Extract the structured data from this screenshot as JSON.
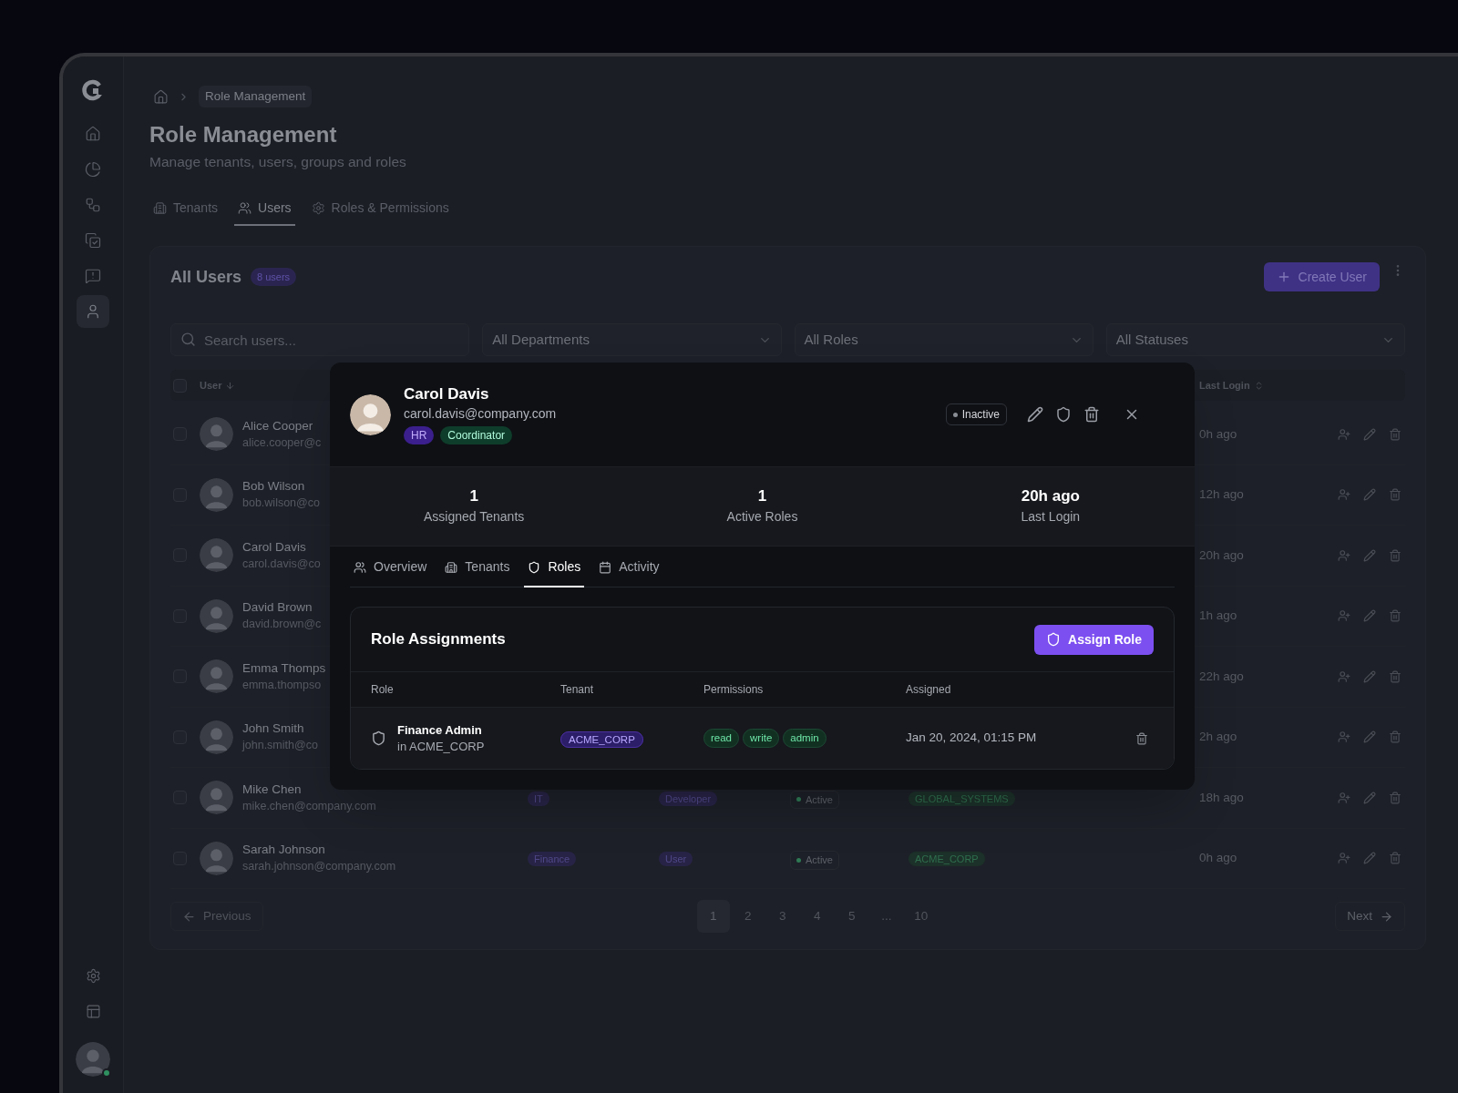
{
  "sidebar": {
    "items": [
      {
        "selected": false
      },
      {
        "selected": false
      },
      {
        "selected": false
      },
      {
        "selected": false
      },
      {
        "selected": false
      },
      {
        "selected": true
      }
    ],
    "bottom_items": [
      {
        "selected": false
      },
      {
        "selected": false
      }
    ],
    "user_avatar": {
      "online": true
    }
  },
  "breadcrumb": {
    "current": "Role Management"
  },
  "header": {
    "title": "Role Management",
    "subtitle": "Manage tenants, users, groups and roles"
  },
  "tabs": [
    {
      "label": "Tenants",
      "selected": false
    },
    {
      "label": "Users",
      "selected": true
    },
    {
      "label": "Roles & Permissions",
      "selected": false
    }
  ],
  "users_card": {
    "title": "All Users",
    "count": "8 users",
    "create_button": "Create User",
    "search": {
      "placeholder": "Search users..."
    },
    "filters": [
      "All Departments",
      "All Roles",
      "All Statuses"
    ],
    "columns": {
      "select_all_checked": false,
      "user": "User",
      "last_login": "Last Login"
    },
    "rows": [
      {
        "checked": false,
        "name": "Alice Cooper",
        "email": "alice.cooper@c",
        "last_login": "0h ago"
      },
      {
        "checked": false,
        "name": "Bob Wilson",
        "email": "bob.wilson@co",
        "last_login": "12h ago"
      },
      {
        "checked": false,
        "name": "Carol Davis",
        "email": "carol.davis@co",
        "last_login": "20h ago"
      },
      {
        "checked": false,
        "name": "David Brown",
        "email": "david.brown@c",
        "last_login": "1h ago"
      },
      {
        "checked": false,
        "name": "Emma Thomps",
        "email": "emma.thompso",
        "last_login": "22h ago"
      },
      {
        "checked": false,
        "name": "John Smith",
        "email": "john.smith@co",
        "last_login": "2h ago"
      },
      {
        "checked": false,
        "name": "Mike Chen",
        "email": "mike.chen@company.com",
        "department": "IT",
        "role": "Developer",
        "status": "Active",
        "tenant": "GLOBAL_SYSTEMS",
        "last_login": "18h ago"
      },
      {
        "checked": false,
        "name": "Sarah Johnson",
        "email": "sarah.johnson@company.com",
        "department": "Finance",
        "role": "User",
        "status": "Active",
        "tenant": "ACME_CORP",
        "last_login": "0h ago"
      }
    ],
    "pagination": {
      "previous": "Previous",
      "pages": [
        {
          "label": "1",
          "selected": true
        },
        {
          "label": "2",
          "selected": false
        },
        {
          "label": "3",
          "selected": false
        },
        {
          "label": "4",
          "selected": false
        },
        {
          "label": "5",
          "selected": false
        },
        {
          "label": "...",
          "selected": false
        },
        {
          "label": "10",
          "selected": false
        }
      ],
      "next": "Next"
    }
  },
  "user_modal": {
    "name": "Carol Davis",
    "email": "carol.davis@company.com",
    "tags": [
      {
        "label": "HR",
        "color": "#3b1f8c"
      },
      {
        "label": "Coordinator",
        "color": "#0f3d2b"
      }
    ],
    "status": "Inactive",
    "stats": [
      {
        "value": "1",
        "label": "Assigned Tenants"
      },
      {
        "value": "1",
        "label": "Active Roles"
      },
      {
        "value": "20h ago",
        "label": "Last Login"
      }
    ],
    "tabs": [
      {
        "label": "Overview",
        "selected": false
      },
      {
        "label": "Tenants",
        "selected": false
      },
      {
        "label": "Roles",
        "selected": true
      },
      {
        "label": "Activity",
        "selected": false
      }
    ],
    "role_assignments": {
      "title": "Role Assignments",
      "assign_button": "Assign Role",
      "columns": [
        "Role",
        "Tenant",
        "Permissions",
        "Assigned"
      ],
      "rows": [
        {
          "role": "Finance Admin",
          "scope": "in ACME_CORP",
          "tenant": "ACME_CORP",
          "permissions": [
            "read",
            "write",
            "admin"
          ],
          "assigned": "Jan 20, 2024, 01:15 PM"
        }
      ]
    }
  }
}
